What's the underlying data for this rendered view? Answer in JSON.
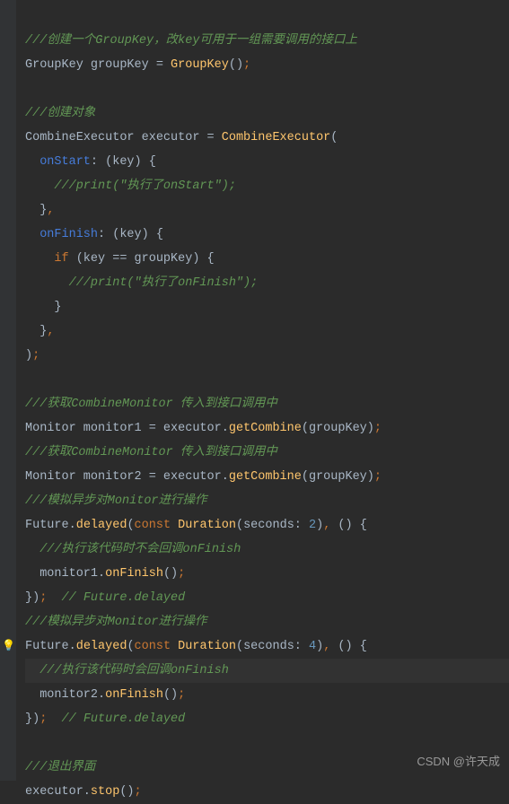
{
  "code": {
    "c1_open": "///",
    "c1_rest": "创建一个GroupKey，改key可用于一组需要调用的接口上",
    "l2a": "GroupKey groupKey = ",
    "l2b": "GroupKey",
    "l2c": "()",
    "l2d": ";",
    "c2_open": "///",
    "c2_rest": "创建对象",
    "l5a": "CombineExecutor executor = ",
    "l5b": "CombineExecutor",
    "l5c": "(",
    "l6a": "onStart",
    "l6b": ": (key) {",
    "l7": "///print(\"执行了onStart\");",
    "l8a": "}",
    "l8b": ",",
    "l9a": "onFinish",
    "l9b": ": (key) {",
    "l10a": "if",
    "l10b": " (key == groupKey) {",
    "l11": "///print(\"执行了onFinish\");",
    "l12": "}",
    "l13a": "}",
    "l13b": ",",
    "l14a": ")",
    "l14b": ";",
    "c3_open": "///",
    "c3_rest": "获取CombineMonitor 传入到接口调用中",
    "l17a": "Monitor monitor1 = executor.",
    "l17b": "getCombine",
    "l17c": "(groupKey)",
    "l17d": ";",
    "c4_open": "///",
    "c4_rest": "获取CombineMonitor 传入到接口调用中",
    "l19a": "Monitor monitor2 = executor.",
    "l19b": "getCombine",
    "l19c": "(groupKey)",
    "l19d": ";",
    "c5_open": "///",
    "c5_rest": "模拟异步对Monitor进行操作",
    "l21a": "Future.",
    "l21b": "delayed",
    "l21c": "(",
    "l21d": "const",
    "l21e": " ",
    "l21f": "Duration",
    "l21g": "(seconds: ",
    "l21h": "2",
    "l21i": ")",
    "l21j": ",",
    "l21k": " () {",
    "l22": "///执行该代码时不会回调onFinish",
    "l23a": "monitor1.",
    "l23b": "onFinish",
    "l23c": "()",
    "l23d": ";",
    "l24a": "})",
    "l24b": ";",
    "l24c": "  // Future.delayed",
    "c6_open": "///",
    "c6_rest": "模拟异步对Monitor进行操作",
    "l26a": "Future.",
    "l26b": "delayed",
    "l26c": "(",
    "l26d": "const",
    "l26e": " ",
    "l26f": "Duration",
    "l26g": "(seconds: ",
    "l26h": "4",
    "l26i": ")",
    "l26j": ",",
    "l26k": " () {",
    "l27": "///执行该代码时会回调onFinish",
    "l28a": "monitor2.",
    "l28b": "onFinish",
    "l28c": "()",
    "l28d": ";",
    "l29a": "})",
    "l29b": ";",
    "l29c": "  // Future.delayed",
    "c7_open": "///",
    "c7_rest": "退出界面",
    "l31a": "executor.",
    "l31b": "stop",
    "l31c": "()",
    "l31d": ";"
  },
  "watermark": "CSDN @许天成",
  "bulb": "💡"
}
